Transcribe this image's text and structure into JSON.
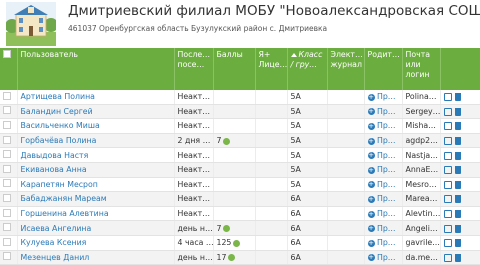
{
  "header": {
    "title": "Дмитриевский филиал МОБУ \"Новоалександровская СОШ\"",
    "subtitle": "461037 Оренбургская область Бузулукский район с. Дмитриевка"
  },
  "table": {
    "columns": [
      "Пользователь",
      "После… посе…",
      "Баллы",
      "Я+ Лице…",
      "Класс / гру…",
      "Элект… журнал",
      "Родит…",
      "Почта или логин"
    ],
    "rows": [
      {
        "name": "Артищева Полина",
        "visit": "Неакт…",
        "score": "",
        "grade": "5А",
        "parents": "Пр…",
        "login": "Polina…"
      },
      {
        "name": "Баландин Сергей",
        "visit": "Неакт…",
        "score": "",
        "grade": "5А",
        "parents": "Пр…",
        "login": "Sergey…"
      },
      {
        "name": "Васильченко Миша",
        "visit": "Неакт…",
        "score": "",
        "grade": "5А",
        "parents": "Пр…",
        "login": "Misha…"
      },
      {
        "name": "Горбачёва Полина",
        "visit": "2 дня …",
        "score": "7",
        "grade": "5А",
        "parents": "Пр…",
        "login": "agdp2…"
      },
      {
        "name": "Давыдова Настя",
        "visit": "Неакт…",
        "score": "",
        "grade": "5А",
        "parents": "Пр…",
        "login": "Nastja…"
      },
      {
        "name": "Екиванова Анна",
        "visit": "Неакт…",
        "score": "",
        "grade": "5А",
        "parents": "Пр…",
        "login": "AnnaE…"
      },
      {
        "name": "Карапетян Месроп",
        "visit": "Неакт…",
        "score": "",
        "grade": "5А",
        "parents": "Пр…",
        "login": "Mesro…"
      },
      {
        "name": "Бабаджанян Мареам",
        "visit": "Неакт…",
        "score": "",
        "grade": "6А",
        "parents": "Пр…",
        "login": "Marea…"
      },
      {
        "name": "Горшенина Алевтина",
        "visit": "Неакт…",
        "score": "",
        "grade": "6А",
        "parents": "Пр…",
        "login": "Alevtin…"
      },
      {
        "name": "Исаева Ангелина",
        "visit": "день н…",
        "score": "7",
        "grade": "6А",
        "parents": "Пр…",
        "login": "Angeli…"
      },
      {
        "name": "Кулуева Ксения",
        "visit": "4 часа …",
        "score": "125",
        "grade": "6А",
        "parents": "Пр…",
        "login": "gavrile…"
      },
      {
        "name": "Мезенцев Данил",
        "visit": "день н…",
        "score": "17",
        "grade": "6А",
        "parents": "Пр…",
        "login": "da.me…"
      }
    ]
  },
  "colors": {
    "accent": "#6cad3f",
    "link": "#2a7ab8"
  }
}
